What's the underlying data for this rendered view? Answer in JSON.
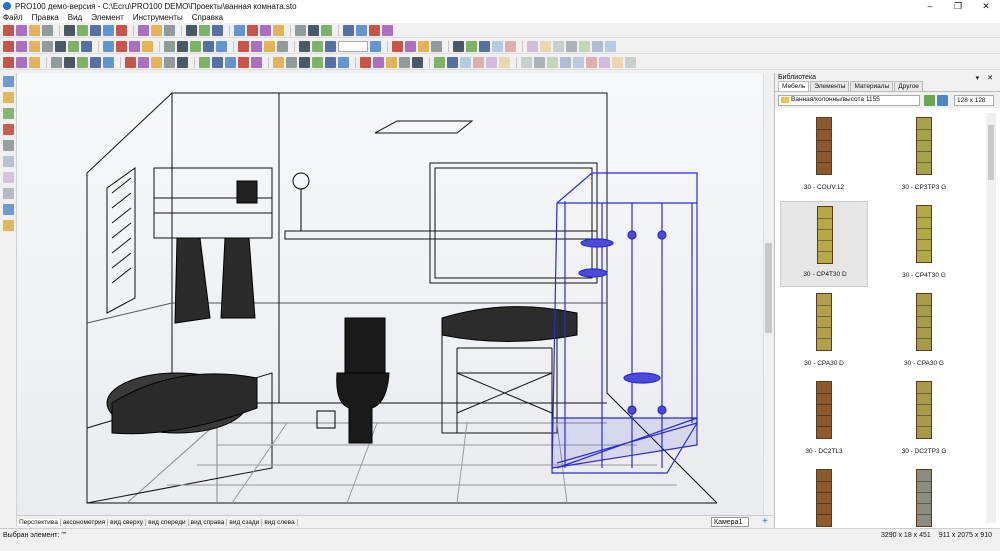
{
  "window": {
    "title": "PRO100 демо-версия - C:\\Ecru\\PRO100 DEMO\\Проекты\\ванная комната.sto",
    "minimize": "‒",
    "maximize": "❐",
    "close": "✕"
  },
  "menu": [
    "Файл",
    "Правка",
    "Вид",
    "Элемент",
    "Инструменты",
    "Справка"
  ],
  "toolbar": {
    "zoom_placeholder": ""
  },
  "viewport": {
    "view_tabs": [
      "Перспектива",
      "аксонометрия",
      "вид сверху",
      "вид спереди",
      "вид справа",
      "вид сзади",
      "вид слева"
    ],
    "active_tab": 0,
    "camera_label": "Камера1",
    "plus": "+"
  },
  "library": {
    "title": "Библиотека",
    "header_buttons": "▾ ✕",
    "tabs": [
      "Мебель",
      "Элементы",
      "Материалы",
      "Другое"
    ],
    "active_tab": 0,
    "path": "Ванная/колонны/высота 1155",
    "thumb_size": "128 x 128",
    "items": [
      {
        "label": "30 - COUV.12",
        "color": "#8a5a2e",
        "selected": false
      },
      {
        "label": "30 - CP3TP3 G",
        "color": "#a7a34a",
        "selected": false
      },
      {
        "label": "30 - CP4T30 D",
        "color": "#b6a947",
        "selected": true
      },
      {
        "label": "30 - CP4T30 G",
        "color": "#b3a84a",
        "selected": false
      },
      {
        "label": "30 - CPA30 D",
        "color": "#b19f4a",
        "selected": false
      },
      {
        "label": "30 - CPA30 G",
        "color": "#a89c48",
        "selected": false
      },
      {
        "label": "30 - DC2TL3",
        "color": "#8c5a2b",
        "selected": false
      },
      {
        "label": "30 - DC2TP3 G",
        "color": "#a89a47",
        "selected": false
      },
      {
        "label": "",
        "color": "#8c5a2b",
        "selected": false
      },
      {
        "label": "",
        "color": "#8e8a84",
        "selected": false
      }
    ]
  },
  "status": {
    "left": "Выбран элемент: \"\"",
    "dims1": "3290 x 18 x 451",
    "dims2": "911 x 2075 x 910"
  }
}
